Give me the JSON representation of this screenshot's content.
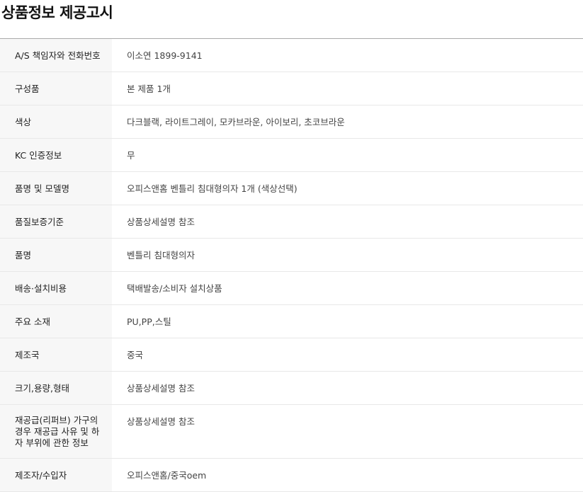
{
  "title": "상품정보 제공고시",
  "rows": [
    {
      "label": "A/S 책임자와 전화번호",
      "value": "이소연 1899-9141"
    },
    {
      "label": "구성품",
      "value": "본 제품 1개"
    },
    {
      "label": "색상",
      "value": "다크블랙, 라이트그레이, 모카브라운, 아이보리, 초코브라운"
    },
    {
      "label": "KC 인증정보",
      "value": "무"
    },
    {
      "label": "품명 및 모델명",
      "value": "오피스앤홈 벤틀리 침대형의자 1개 (색상선택)"
    },
    {
      "label": "품질보증기준",
      "value": "상품상세설명 참조"
    },
    {
      "label": "품명",
      "value": "벤틀리 침대형의자"
    },
    {
      "label": "배송·설치비용",
      "value": "택배발송/소비자 설치상품"
    },
    {
      "label": "주요 소재",
      "value": "PU,PP,스틸"
    },
    {
      "label": "제조국",
      "value": "중국"
    },
    {
      "label": "크기,용량,형태",
      "value": "상품상세설명 참조"
    },
    {
      "label": "재공급(리퍼브) 가구의 경우 재공급 사유 및 하자 부위에 관한 정보",
      "value": "상품상세설명 참조"
    },
    {
      "label": "제조자/수입자",
      "value": "오피스앤홈/중국oem"
    }
  ]
}
